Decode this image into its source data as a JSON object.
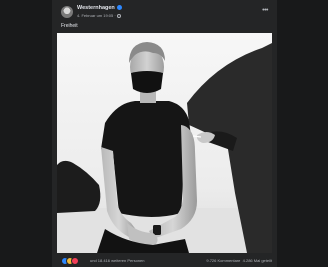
{
  "post": {
    "author": "Westernhagen",
    "timestamp": "4. Februar um 19:05 ·",
    "caption": "Freiheit",
    "reactions": {
      "summary": "und 18.416 weiteren Personen"
    },
    "stats": {
      "comments": "9.726 Kommentare",
      "shares": "4.286 Mal geteilt"
    },
    "colors": {
      "background": "#18191a",
      "card": "#242526",
      "text_primary": "#e4e6eb",
      "text_secondary": "#b0b3b8",
      "verified": "#2d88ff"
    },
    "icons": [
      "verified-icon",
      "globe-icon",
      "more-icon",
      "like-icon",
      "love-icon",
      "haha-icon"
    ]
  }
}
